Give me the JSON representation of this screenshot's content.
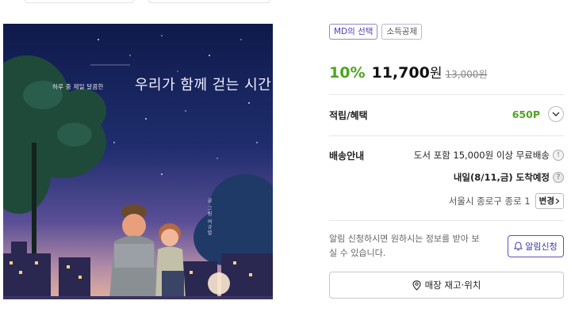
{
  "book": {
    "cover_subtitle": "하루 중 제일 달콤한",
    "cover_title": "우리가 함께 걷는 시간",
    "cover_author": "글·그림 여규렬"
  },
  "badges": {
    "md_pick": "MD의 선택",
    "tax_deduction": "소득공제"
  },
  "pricing": {
    "discount": "10%",
    "price": "11,700",
    "unit": "원",
    "original_price": "13,000원"
  },
  "points": {
    "label": "적립/혜택",
    "value": "650P"
  },
  "shipping": {
    "label": "배송안내",
    "free_shipping": "도서 포함 15,000원 이상 무료배송",
    "arrival_date": "내일(8/11,금)",
    "arrival_suffix": "도착예정",
    "address": "서울시 종로구 종로 1",
    "change_label": "변경"
  },
  "alert": {
    "text": "알림 신청하시면 원하시는 정보를 받아 보실 수 있습니다.",
    "button_label": "알림신청"
  },
  "store": {
    "button_label": "매장 재고·위치"
  },
  "colors": {
    "accent_green": "#4fa41f",
    "accent_purple": "#4a3fb5",
    "cover_sky": "#111b4a"
  }
}
